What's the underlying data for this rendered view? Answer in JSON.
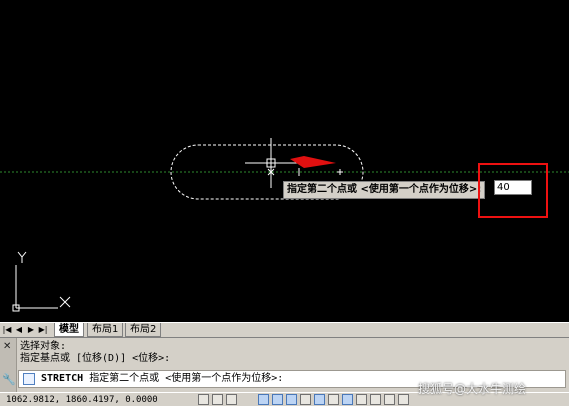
{
  "dynamic_input": {
    "prompt": "指定第二个点或 <使用第一个点作为位移>:",
    "value": "40"
  },
  "ucs": {
    "x_label": "X",
    "y_label": "Y"
  },
  "layout_tabs": [
    {
      "label": "模型",
      "active": true
    },
    {
      "label": "布局1",
      "active": false
    },
    {
      "label": "布局2",
      "active": false
    }
  ],
  "command_window": {
    "history": [
      "选择对象:",
      "指定基点或 [位移(D)] <位移>:"
    ],
    "current_command": "STRETCH",
    "current_prompt": "指定第二个点或 <使用第一个点作为位移>:"
  },
  "status_bar": {
    "coordinates": "1062.9812, 1860.4197, 0.0000"
  },
  "watermark": "搜狐号@大水牛测绘",
  "colors": {
    "canvas_bg": "#000000",
    "highlight": "#e11111",
    "arrow": "#e01010",
    "grid_line": "#2e8a2e"
  }
}
